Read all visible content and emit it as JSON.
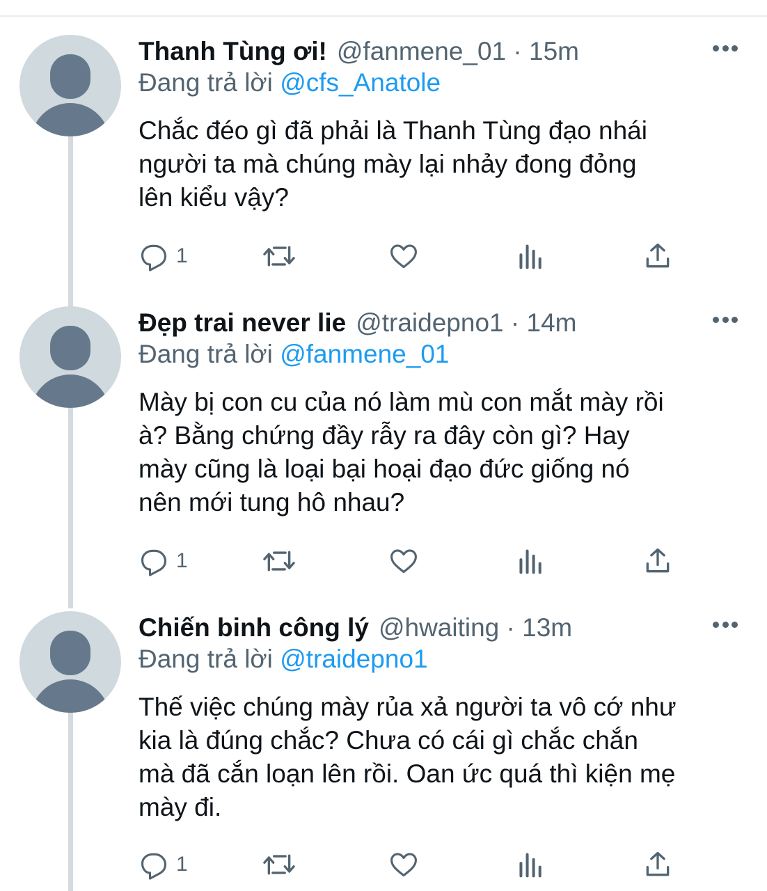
{
  "tweets": [
    {
      "name": "Thanh Tùng ơi!",
      "meta": "@fanmene_01 · 15m",
      "replying_prefix": "Đang trả lời",
      "replying_handle": "@cfs_Anatole",
      "content": "Chắc đéo gì đã phải là Thanh Tùng đạo nhái\nngười ta mà chúng mày lại nhảy đong đỏng\nlên kiểu vậy?",
      "reply_count": "1"
    },
    {
      "name": "Đẹp trai never lie",
      "meta": "@traidepno1 · 14m",
      "replying_prefix": "Đang trả lời",
      "replying_handle": "@fanmene_01",
      "content": "Mày bị con cu của nó làm mù con mắt mày rồi\nà? Bằng chứng đầy rẫy ra đây còn gì? Hay\nmày cũng là loại bại hoại đạo đức giống nó\nnên mới tung hô nhau?",
      "reply_count": "1"
    },
    {
      "name": "Chiến binh công lý",
      "meta": "@hwaiting · 13m",
      "replying_prefix": "Đang trả lời",
      "replying_handle": "@traidepno1",
      "content": "Thế việc chúng mày rủa xả người ta vô cớ như\nkia là đúng chắc? Chưa có cái gì chắc chắn\nmà đã cắn loạn lên rồi. Oan ức quá thì kiện mẹ\nmày đi.",
      "reply_count": "1"
    }
  ],
  "icons": {
    "reply": "reply-icon",
    "retweet": "retweet-icon",
    "like": "heart-icon",
    "analytics": "analytics-icon",
    "share": "share-icon",
    "more": "more-icon"
  },
  "colors": {
    "link": "#1d9bf0",
    "secondary_text": "#536471",
    "avatar_bg": "#cfd9de",
    "avatar_fg": "#66798c",
    "thread_line": "#d4dade"
  }
}
